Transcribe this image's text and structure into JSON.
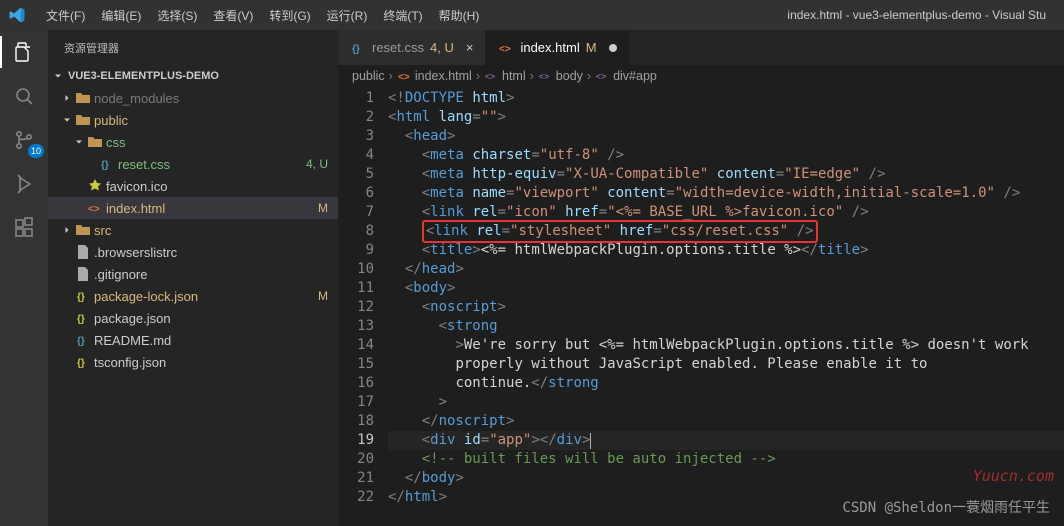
{
  "title": "index.html - vue3-elementplus-demo - Visual Stu",
  "menu": [
    "文件(F)",
    "编辑(E)",
    "选择(S)",
    "查看(V)",
    "转到(G)",
    "运行(R)",
    "终端(T)",
    "帮助(H)"
  ],
  "activity": {
    "scm_badge": "10"
  },
  "sidebar": {
    "header": "资源管理器",
    "section": "VUE3-ELEMENTPLUS-DEMO",
    "tree": [
      {
        "indent": 1,
        "chev": "right",
        "icon": "folder",
        "label": "node_modules",
        "cls": "ignored",
        "meta": ""
      },
      {
        "indent": 1,
        "chev": "down",
        "icon": "folder",
        "label": "public",
        "cls": "modified",
        "meta": ""
      },
      {
        "indent": 2,
        "chev": "down",
        "icon": "folder",
        "label": "css",
        "cls": "untracked",
        "meta": ""
      },
      {
        "indent": 3,
        "chev": "",
        "icon": "css",
        "label": "reset.css",
        "cls": "untracked",
        "meta": "4, U"
      },
      {
        "indent": 2,
        "chev": "",
        "icon": "fav",
        "label": "favicon.ico",
        "cls": "",
        "meta": ""
      },
      {
        "indent": 2,
        "chev": "",
        "icon": "html",
        "label": "index.html",
        "cls": "modified selected",
        "meta": "M"
      },
      {
        "indent": 1,
        "chev": "right",
        "icon": "folder",
        "label": "src",
        "cls": "modified",
        "meta": ""
      },
      {
        "indent": 1,
        "chev": "",
        "icon": "file",
        "label": ".browserslistrc",
        "cls": "",
        "meta": ""
      },
      {
        "indent": 1,
        "chev": "",
        "icon": "file",
        "label": ".gitignore",
        "cls": "",
        "meta": ""
      },
      {
        "indent": 1,
        "chev": "",
        "icon": "json",
        "label": "package-lock.json",
        "cls": "modified",
        "meta": "M"
      },
      {
        "indent": 1,
        "chev": "",
        "icon": "json",
        "label": "package.json",
        "cls": "",
        "meta": ""
      },
      {
        "indent": 1,
        "chev": "",
        "icon": "md",
        "label": "README.md",
        "cls": "",
        "meta": ""
      },
      {
        "indent": 1,
        "chev": "",
        "icon": "json",
        "label": "tsconfig.json",
        "cls": "",
        "meta": ""
      }
    ]
  },
  "tabs": [
    {
      "icon": "css",
      "label": "reset.css",
      "suffix": "4, U",
      "mod": true,
      "active": false,
      "dirty": false
    },
    {
      "icon": "html",
      "label": "index.html",
      "suffix": "M",
      "mod": true,
      "active": true,
      "dirty": true
    }
  ],
  "breadcrumbs": [
    {
      "icon": "",
      "label": "public"
    },
    {
      "icon": "html",
      "label": "index.html"
    },
    {
      "icon": "sym",
      "label": "html"
    },
    {
      "icon": "sym",
      "label": "body"
    },
    {
      "icon": "sym",
      "label": "div#app"
    }
  ],
  "code": {
    "lines": [
      {
        "n": 1,
        "t": [
          [
            "p",
            "<!"
          ],
          [
            "t",
            "DOCTYPE"
          ],
          [
            "x",
            " "
          ],
          [
            "a",
            "html"
          ],
          [
            "p",
            ">"
          ]
        ]
      },
      {
        "n": 2,
        "t": [
          [
            "p",
            "<"
          ],
          [
            "t",
            "html"
          ],
          [
            "x",
            " "
          ],
          [
            "a",
            "lang"
          ],
          [
            "p",
            "="
          ],
          [
            "s",
            "\"\""
          ],
          [
            "p",
            ">"
          ]
        ]
      },
      {
        "n": 3,
        "i": 1,
        "t": [
          [
            "p",
            "<"
          ],
          [
            "t",
            "head"
          ],
          [
            "p",
            ">"
          ]
        ]
      },
      {
        "n": 4,
        "i": 2,
        "t": [
          [
            "p",
            "<"
          ],
          [
            "t",
            "meta"
          ],
          [
            "x",
            " "
          ],
          [
            "a",
            "charset"
          ],
          [
            "p",
            "="
          ],
          [
            "s",
            "\"utf-8\""
          ],
          [
            "x",
            " "
          ],
          [
            "p",
            "/>"
          ]
        ]
      },
      {
        "n": 5,
        "i": 2,
        "t": [
          [
            "p",
            "<"
          ],
          [
            "t",
            "meta"
          ],
          [
            "x",
            " "
          ],
          [
            "a",
            "http-equiv"
          ],
          [
            "p",
            "="
          ],
          [
            "s",
            "\"X-UA-Compatible\""
          ],
          [
            "x",
            " "
          ],
          [
            "a",
            "content"
          ],
          [
            "p",
            "="
          ],
          [
            "s",
            "\"IE=edge\""
          ],
          [
            "x",
            " "
          ],
          [
            "p",
            "/>"
          ]
        ]
      },
      {
        "n": 6,
        "i": 2,
        "t": [
          [
            "p",
            "<"
          ],
          [
            "t",
            "meta"
          ],
          [
            "x",
            " "
          ],
          [
            "a",
            "name"
          ],
          [
            "p",
            "="
          ],
          [
            "s",
            "\"viewport\""
          ],
          [
            "x",
            " "
          ],
          [
            "a",
            "content"
          ],
          [
            "p",
            "="
          ],
          [
            "s",
            "\"width=device-width,initial-scale=1.0\""
          ],
          [
            "x",
            " "
          ],
          [
            "p",
            "/>"
          ]
        ]
      },
      {
        "n": 7,
        "i": 2,
        "t": [
          [
            "p",
            "<"
          ],
          [
            "t",
            "link"
          ],
          [
            "x",
            " "
          ],
          [
            "a",
            "rel"
          ],
          [
            "p",
            "="
          ],
          [
            "s",
            "\"icon\""
          ],
          [
            "x",
            " "
          ],
          [
            "a",
            "href"
          ],
          [
            "p",
            "="
          ],
          [
            "s",
            "\"<%= BASE_URL %>favicon.ico\""
          ],
          [
            "x",
            " "
          ],
          [
            "p",
            "/>"
          ]
        ]
      },
      {
        "n": 8,
        "i": 2,
        "hl": true,
        "t": [
          [
            "p",
            "<"
          ],
          [
            "t",
            "link"
          ],
          [
            "x",
            " "
          ],
          [
            "a",
            "rel"
          ],
          [
            "p",
            "="
          ],
          [
            "s",
            "\"stylesheet\""
          ],
          [
            "x",
            " "
          ],
          [
            "a",
            "href"
          ],
          [
            "p",
            "="
          ],
          [
            "s",
            "\"css/reset.css\""
          ],
          [
            "x",
            " "
          ],
          [
            "p",
            "/>"
          ]
        ]
      },
      {
        "n": 9,
        "i": 2,
        "t": [
          [
            "p",
            "<"
          ],
          [
            "t",
            "title"
          ],
          [
            "p",
            ">"
          ],
          [
            "x",
            "<%= htmlWebpackPlugin.options.title %>"
          ],
          [
            "p",
            "</"
          ],
          [
            "t",
            "title"
          ],
          [
            "p",
            ">"
          ]
        ]
      },
      {
        "n": 10,
        "i": 1,
        "t": [
          [
            "p",
            "</"
          ],
          [
            "t",
            "head"
          ],
          [
            "p",
            ">"
          ]
        ]
      },
      {
        "n": 11,
        "i": 1,
        "t": [
          [
            "p",
            "<"
          ],
          [
            "t",
            "body"
          ],
          [
            "p",
            ">"
          ]
        ]
      },
      {
        "n": 12,
        "i": 2,
        "t": [
          [
            "p",
            "<"
          ],
          [
            "t",
            "noscript"
          ],
          [
            "p",
            ">"
          ]
        ]
      },
      {
        "n": 13,
        "i": 3,
        "t": [
          [
            "p",
            "<"
          ],
          [
            "t",
            "strong"
          ]
        ]
      },
      {
        "n": 14,
        "i": 4,
        "t": [
          [
            "p",
            ">"
          ],
          [
            "x",
            "We're sorry but <%= htmlWebpackPlugin.options.title %> doesn't work"
          ]
        ]
      },
      {
        "n": 15,
        "i": 4,
        "t": [
          [
            "x",
            "properly without JavaScript enabled. Please enable it to"
          ]
        ]
      },
      {
        "n": 16,
        "i": 4,
        "t": [
          [
            "x",
            "continue."
          ],
          [
            "p",
            "</"
          ],
          [
            "t",
            "strong"
          ]
        ]
      },
      {
        "n": 17,
        "i": 3,
        "t": [
          [
            "p",
            ">"
          ]
        ]
      },
      {
        "n": 18,
        "i": 2,
        "t": [
          [
            "p",
            "</"
          ],
          [
            "t",
            "noscript"
          ],
          [
            "p",
            ">"
          ]
        ]
      },
      {
        "n": 19,
        "i": 2,
        "current": true,
        "t": [
          [
            "p",
            "<"
          ],
          [
            "t",
            "div"
          ],
          [
            "x",
            " "
          ],
          [
            "a",
            "id"
          ],
          [
            "p",
            "="
          ],
          [
            "s",
            "\"app\""
          ],
          [
            "p",
            ">"
          ],
          [
            "p",
            "</"
          ],
          [
            "t",
            "div"
          ],
          [
            "p",
            ">"
          ],
          [
            "cur",
            ""
          ]
        ]
      },
      {
        "n": 20,
        "i": 2,
        "t": [
          [
            "c",
            "<!-- built files will be auto injected -->"
          ]
        ]
      },
      {
        "n": 21,
        "i": 1,
        "t": [
          [
            "p",
            "</"
          ],
          [
            "t",
            "body"
          ],
          [
            "p",
            ">"
          ]
        ]
      },
      {
        "n": 22,
        "t": [
          [
            "p",
            "</"
          ],
          [
            "t",
            "html"
          ],
          [
            "p",
            ">"
          ]
        ]
      }
    ]
  },
  "watermark1": "Yuucn.com",
  "watermark2": "CSDN @Sheldon一蓑烟雨任平生"
}
